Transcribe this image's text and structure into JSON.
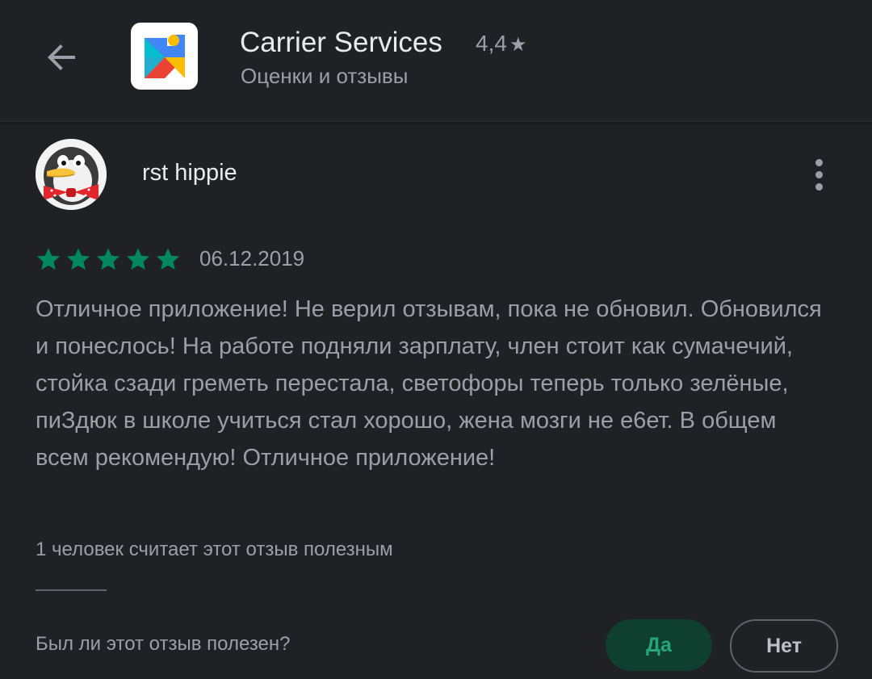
{
  "header": {
    "back_icon": "arrow-left-icon",
    "app_icon": "google-play-services-icon",
    "app_title": "Carrier Services",
    "rating": "4,4",
    "rating_star": "★",
    "subtitle": "Оценки и отзывы"
  },
  "review": {
    "avatar": "penguin-avatar",
    "author": "rst hippie",
    "more_icon": "more-vert-icon",
    "stars": 5,
    "max_stars": 5,
    "date": "06.12.2019",
    "text": "Отличное приложение! Не верил отзывам, пока не обновил. Обновился и понеслось! На работе подняли зарплату, член стоит как сумачечий, стойка сзади греметь перестала, светофоры теперь только зелёные, пиЗдюк в школе учиться стал хорошо, жена мозги не е6ет. В общем всем рекомендую! Отличное приложение!",
    "helpful_count": "1 человек считает этот отзыв полезным",
    "question": "Был ли этот отзыв полезен?",
    "yes_label": "Да",
    "no_label": "Нет"
  },
  "colors": {
    "background": "#202124",
    "star_green": "#01875f",
    "yes_bg": "#0f3f2e",
    "yes_text": "#26a67a",
    "secondary_text": "#9aa0a6"
  }
}
